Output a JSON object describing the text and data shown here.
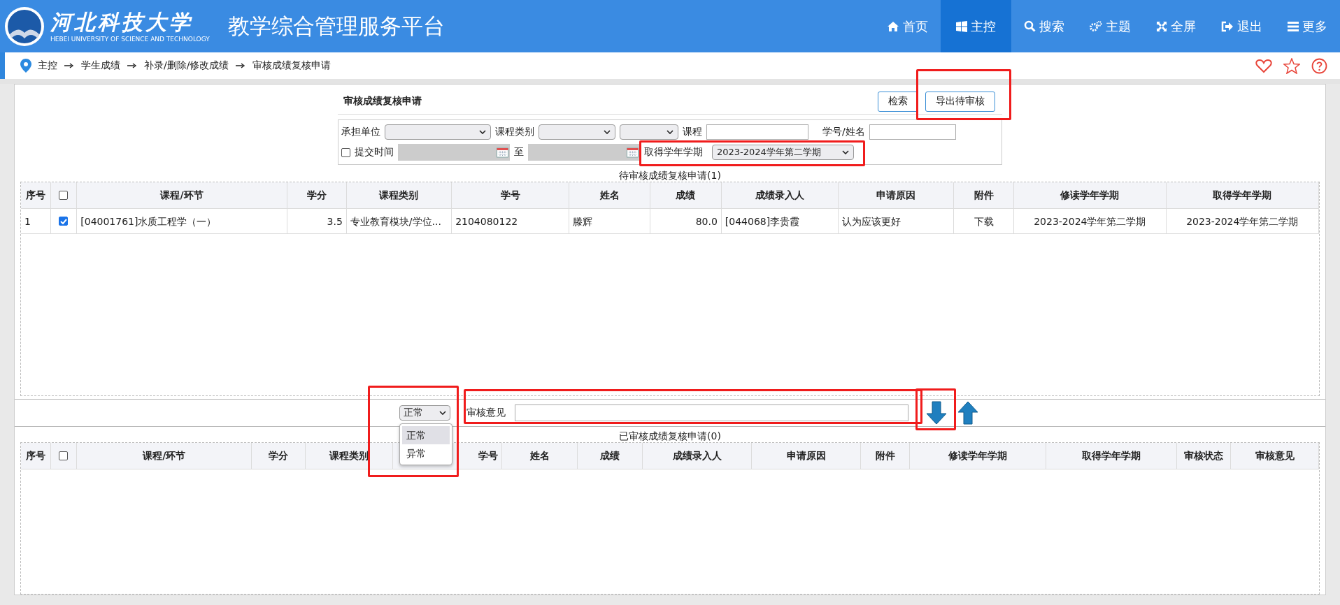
{
  "header": {
    "logo_text": "河北科技大学",
    "logo_subtext": "HEBEI UNIVERSITY OF SCIENCE AND TECHNOLOGY",
    "title": "教学综合管理服务平台",
    "nav": [
      {
        "label": "首页",
        "selected": false
      },
      {
        "label": "主控",
        "selected": true
      },
      {
        "label": "搜索",
        "selected": false
      },
      {
        "label": "主题",
        "selected": false
      },
      {
        "label": "全屏",
        "selected": false
      },
      {
        "label": "退出",
        "selected": false
      },
      {
        "label": "更多",
        "selected": false
      }
    ]
  },
  "breadcrumb": [
    "主控",
    "学生成绩",
    "补录/删除/修改成绩",
    "审核成绩复核申请"
  ],
  "form": {
    "title": "审核成绩复核申请",
    "buttons": [
      "检索",
      "导出待审核"
    ],
    "filters": {
      "unit_label": "承担单位",
      "type_label": "课程类别",
      "course_label": "课程",
      "student_label": "学号/姓名",
      "submit_time": {
        "label": "提交时间",
        "checked": false
      },
      "to_label": "至",
      "term_label": "取得学年学期",
      "term_value": "2023-2024学年第二学期"
    }
  },
  "pending_table": {
    "caption": "待审核成绩复核申请(1)",
    "header_checked": false,
    "columns": [
      "序号",
      "课程/环节",
      "学分",
      "课程类别",
      "学号",
      "姓名",
      "成绩",
      "成绩录入人",
      "申请原因",
      "附件",
      "修读学年学期",
      "取得学年学期"
    ],
    "rows": [
      {
        "checked": true,
        "cells": [
          "1",
          "[04001761]水质工程学（一）",
          "3.5",
          "专业教育模块/学位...",
          "2104080122",
          "滕辉",
          "80.0",
          "[044068]李贵霞",
          "认为应该更好",
          "下载",
          "2023-2024学年第二学期",
          "2023-2024学年第二学期"
        ]
      }
    ]
  },
  "review_bar": {
    "result_select": {
      "value": "正常",
      "expanded": true,
      "options": [
        {
          "label": "正常",
          "selected": true
        },
        {
          "label": "异常",
          "selected": false
        }
      ]
    },
    "opinion_label": "审核意见"
  },
  "reviewed_table": {
    "caption": "已审核成绩复核申请(0)",
    "header_checked": false,
    "columns": [
      "序号",
      "课程/环节",
      "学分",
      "课程类别",
      "学号",
      "姓名",
      "成绩",
      "成绩录入人",
      "申请原因",
      "附件",
      "修读学年学期",
      "取得学年学期",
      "审核状态",
      "审核意见"
    ]
  }
}
